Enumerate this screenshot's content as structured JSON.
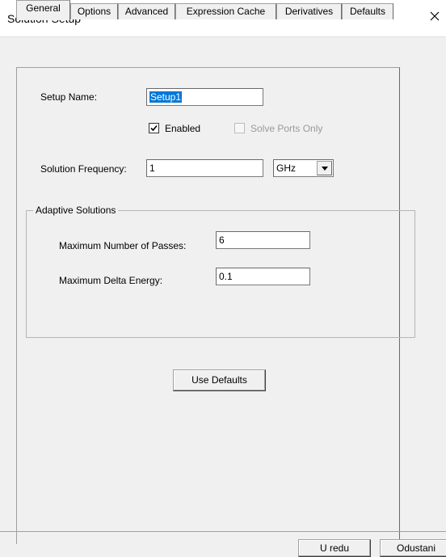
{
  "window": {
    "title": "Solution Setup"
  },
  "tabs": [
    {
      "label": "General",
      "active": true
    },
    {
      "label": "Options"
    },
    {
      "label": "Advanced"
    },
    {
      "label": "Expression Cache"
    },
    {
      "label": "Derivatives"
    },
    {
      "label": "Defaults"
    }
  ],
  "general": {
    "setup_name_label": "Setup Name:",
    "setup_name_value": "Setup1",
    "enabled_label": "Enabled",
    "enabled_checked": true,
    "solve_ports_only_label": "Solve Ports Only",
    "solve_ports_only_checked": false,
    "solution_frequency_label": "Solution Frequency:",
    "solution_frequency_value": "1",
    "frequency_unit": "GHz",
    "adaptive": {
      "title": "Adaptive Solutions",
      "max_passes_label": "Maximum Number of Passes:",
      "max_passes_value": "6",
      "max_delta_energy_label": "Maximum Delta Energy:",
      "max_delta_energy_value": "0.1"
    },
    "use_defaults_label": "Use Defaults"
  },
  "footer": {
    "ok_label": "U redu",
    "cancel_label": "Odustani"
  }
}
